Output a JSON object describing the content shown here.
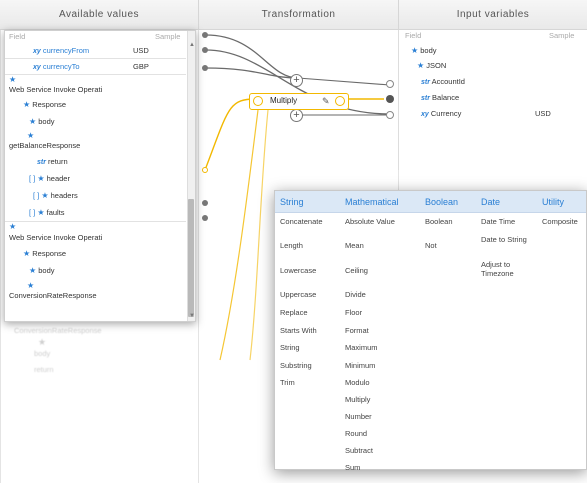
{
  "columns": {
    "available": "Available values",
    "transformation": "Transformation",
    "input": "Input variables"
  },
  "left": {
    "field_header": "Field",
    "sample_header": "Sample",
    "rows": [
      {
        "type_icon": "xy",
        "label": "currencyFrom",
        "sample": "USD"
      },
      {
        "type_icon": "xy",
        "label": "currencyTo",
        "sample": "GBP"
      }
    ],
    "tree": [
      {
        "label": "Web Service Invoke Operati"
      },
      {
        "label": "Response"
      },
      {
        "label": "body"
      },
      {
        "label": "getBalanceResponse"
      },
      {
        "type_icon": "str",
        "label": "return"
      },
      {
        "label": "header"
      },
      {
        "label": "headers"
      },
      {
        "label": "faults"
      },
      {
        "label": "Web Service Invoke Operati"
      },
      {
        "label": "Response"
      },
      {
        "label": "body"
      },
      {
        "label": "ConversionRateResponse"
      }
    ]
  },
  "right": {
    "field_header": "Field",
    "sample_header": "Sample",
    "rows": [
      {
        "label": "body"
      },
      {
        "label": "JSON"
      },
      {
        "type_icon": "str",
        "label": "AccountId"
      },
      {
        "type_icon": "str",
        "label": "Balance"
      },
      {
        "type_icon": "xy",
        "label": "Currency",
        "sample": "USD"
      }
    ]
  },
  "transform": {
    "node_label": "Multiply",
    "plus": "+"
  },
  "functions": {
    "tabs": [
      "String",
      "Mathematical",
      "Boolean",
      "Date",
      "Utility"
    ],
    "string": [
      "Concatenate",
      "Length",
      "Lowercase",
      "Uppercase",
      "Replace",
      "Starts With",
      "String",
      "Substring",
      "Trim"
    ],
    "mathematical": [
      "Absolute Value",
      "Mean",
      "Ceiling",
      "Divide",
      "Floor",
      "Format",
      "Maximum",
      "Minimum",
      "Modulo",
      "Multiply",
      "Number",
      "Round",
      "Subtract",
      "Sum"
    ],
    "boolean": [
      "Boolean",
      "Not"
    ],
    "date": [
      "Date Time",
      "Date to String",
      "Adjust to Timezone"
    ],
    "utility": [
      "Composite"
    ]
  },
  "colors": {
    "accent": "#2a7fd4",
    "connector": "#f2b800"
  }
}
